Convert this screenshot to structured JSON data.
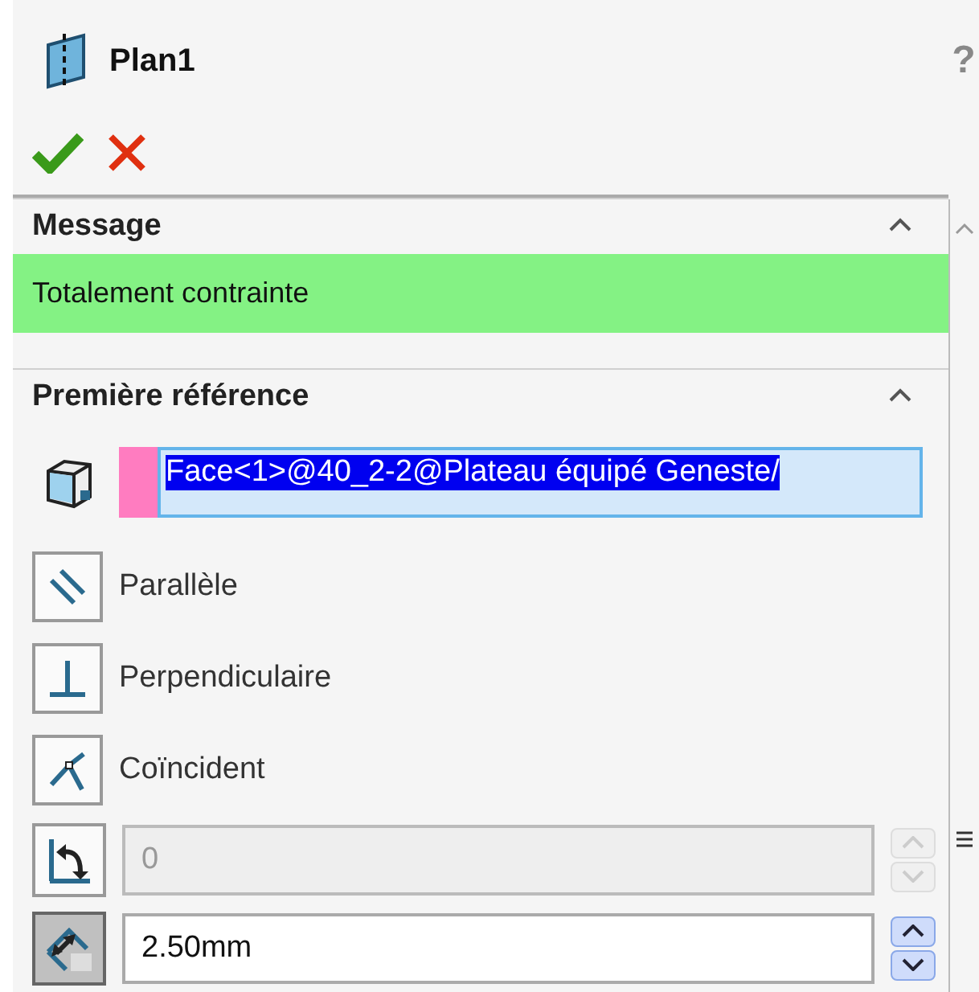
{
  "title": "Plan1",
  "help": "?",
  "message": {
    "title": "Message",
    "expanded": true,
    "text": "Totalement contrainte"
  },
  "reference": {
    "title": "Première référence",
    "expanded": true,
    "selection": {
      "value": "Face<1>@40_2-2@Plateau équipé Geneste/",
      "selected": true
    },
    "constraints": [
      {
        "kind": "parallel",
        "label": "Parallèle",
        "selected": false
      },
      {
        "kind": "perpendicular",
        "label": "Perpendiculaire",
        "selected": false
      },
      {
        "kind": "coincident",
        "label": "Coïncident",
        "selected": false
      }
    ],
    "fields": [
      {
        "kind": "angle",
        "value": "0",
        "disabled": true,
        "on": false
      },
      {
        "kind": "distance",
        "value": "2.50mm",
        "disabled": false,
        "on": true
      }
    ]
  }
}
